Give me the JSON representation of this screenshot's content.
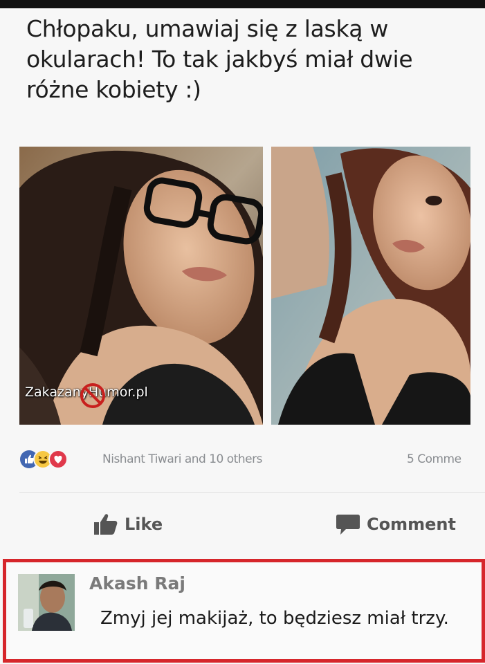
{
  "post": {
    "text": "Chłopaku, umawiaj się z laską w okularach! To tak jakbyś miał dwie różne kobiety :)"
  },
  "photos": {
    "watermark": "ZakazanyHumor.pl"
  },
  "reactions": {
    "icons": [
      "like-reaction-icon",
      "haha-reaction-icon",
      "love-reaction-icon"
    ],
    "names": "Nishant Tiwari and 10 others",
    "comments_count": "5 Comme"
  },
  "actions": {
    "like_label": "Like",
    "comment_label": "Comment"
  },
  "comment": {
    "author": "Akash Raj",
    "text": "Zmyj jej makijaż, to będziesz miał trzy."
  },
  "colors": {
    "highlight_border": "#d6262b",
    "like_blue": "#4267b2",
    "love_red": "#e0394b",
    "haha_yellow": "#f7c843"
  }
}
